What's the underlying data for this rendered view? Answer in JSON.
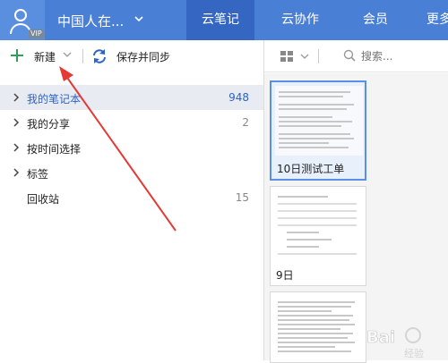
{
  "header": {
    "username": "中国人在...",
    "vip_badge": "VIP",
    "tabs": [
      {
        "label": "云笔记",
        "active": true
      },
      {
        "label": "云协作",
        "active": false
      },
      {
        "label": "会员",
        "active": false
      },
      {
        "label": "更多",
        "active": false
      }
    ]
  },
  "toolbar": {
    "new_label": "新建",
    "sync_label": "保存并同步"
  },
  "sidebar": {
    "items": [
      {
        "label": "我的笔记本",
        "count": "948",
        "selected": true,
        "has_arrow": true
      },
      {
        "label": "我的分享",
        "count": "2",
        "selected": false,
        "has_arrow": true
      },
      {
        "label": "按时间选择",
        "count": "",
        "selected": false,
        "has_arrow": true
      },
      {
        "label": "标签",
        "count": "",
        "selected": false,
        "has_arrow": true
      },
      {
        "label": "回收站",
        "count": "15",
        "selected": false,
        "has_arrow": false
      }
    ]
  },
  "notes_panel": {
    "search_placeholder": "搜索...",
    "notes": [
      {
        "title": "10日测试工单",
        "selected": true
      },
      {
        "title": "9日",
        "selected": false
      },
      {
        "title": "",
        "selected": false
      }
    ]
  },
  "colors": {
    "header_bg": "#4a7fd6",
    "active_tab": "#3466c2",
    "accent_green": "#2e9e58",
    "selected_text": "#2d62c8",
    "annotation_red": "#e53935"
  },
  "watermark": "Bai 经验"
}
